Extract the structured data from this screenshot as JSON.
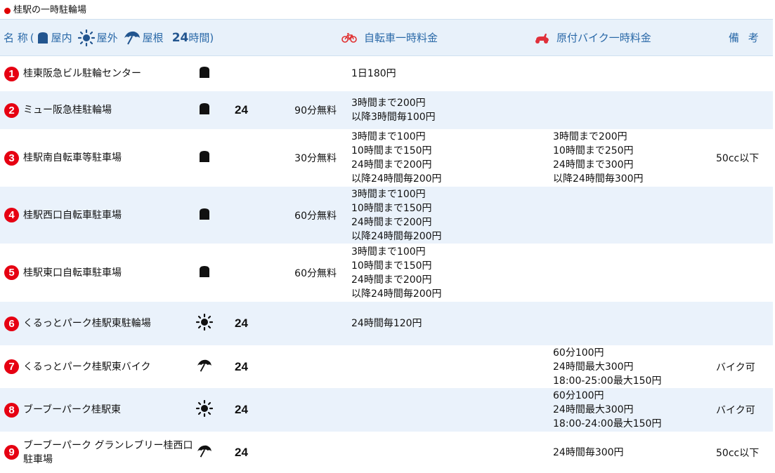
{
  "title": "桂駅の一時駐輪場",
  "header": {
    "name_label": "名 称",
    "paren_open": "(",
    "indoor": "屋内",
    "outdoor": "屋外",
    "roof": "屋根",
    "h24": "24",
    "h24_suffix": "時間)",
    "bicycle_fee": "自転車一時料金",
    "moped_fee": "原付バイク一時料金",
    "note": "備 考"
  },
  "colors": {
    "accent": "#2a69a8",
    "number_badge": "#e60012",
    "alt_row": "#eaf2fb",
    "moped_icon": "#e0303a"
  },
  "rows": [
    {
      "num": "1",
      "name": [
        "桂東阪急ビル駐輪センター"
      ],
      "icon": "indoor-icon",
      "h24": "",
      "free": "",
      "bicycle": [
        "1日180円"
      ],
      "moped": [],
      "note": ""
    },
    {
      "num": "2",
      "name": [
        "ミュー阪急桂駐輪場"
      ],
      "icon": "indoor-icon",
      "h24": "24",
      "free": "90分無料",
      "bicycle": [
        "3時間まで200円",
        "以降3時間毎100円"
      ],
      "moped": [],
      "note": ""
    },
    {
      "num": "3",
      "name": [
        "桂駅南自転車等駐車場"
      ],
      "icon": "indoor-icon",
      "h24": "",
      "free": "30分無料",
      "bicycle": [
        "3時間まで100円",
        "10時間まで150円",
        "24時間まで200円",
        "以降24時間毎200円"
      ],
      "moped": [
        "3時間まで200円",
        "10時間まで250円",
        "24時間まで300円",
        "以降24時間毎300円"
      ],
      "note": "50cc以下"
    },
    {
      "num": "4",
      "name": [
        "桂駅西口自転車駐車場"
      ],
      "icon": "indoor-icon",
      "h24": "",
      "free": "60分無料",
      "bicycle": [
        "3時間まで100円",
        "10時間まで150円",
        "24時間まで200円",
        "以降24時間毎200円"
      ],
      "moped": [],
      "note": ""
    },
    {
      "num": "5",
      "name": [
        "桂駅東口自転車駐車場"
      ],
      "icon": "indoor-icon",
      "h24": "",
      "free": "60分無料",
      "bicycle": [
        "3時間まで100円",
        "10時間まで150円",
        "24時間まで200円",
        "以降24時間毎200円"
      ],
      "moped": [],
      "note": ""
    },
    {
      "num": "6",
      "name": [
        "くるっとパーク桂駅東駐輪場"
      ],
      "icon": "outdoor-icon",
      "h24": "24",
      "free": "",
      "bicycle": [
        "24時間毎120円"
      ],
      "moped": [],
      "note": ""
    },
    {
      "num": "7",
      "name": [
        "くるっとパーク桂駅東バイク"
      ],
      "icon": "roof-icon",
      "h24": "24",
      "free": "",
      "bicycle": [],
      "moped": [
        "60分100円",
        "24時間最大300円",
        "18:00-25:00最大150円"
      ],
      "note": "バイク可"
    },
    {
      "num": "8",
      "name": [
        "ブーブーパーク桂駅東"
      ],
      "icon": "outdoor-icon",
      "h24": "24",
      "free": "",
      "bicycle": [],
      "moped": [
        "60分100円",
        "24時間最大300円",
        "18:00-24:00最大150円"
      ],
      "note": "バイク可"
    },
    {
      "num": "9",
      "name": [
        "ブーブーパーク グランレブリー桂西口",
        "駐車場"
      ],
      "icon": "roof-icon",
      "h24": "24",
      "free": "",
      "bicycle": [],
      "moped": [
        "24時間毎300円"
      ],
      "note": "50cc以下"
    }
  ]
}
